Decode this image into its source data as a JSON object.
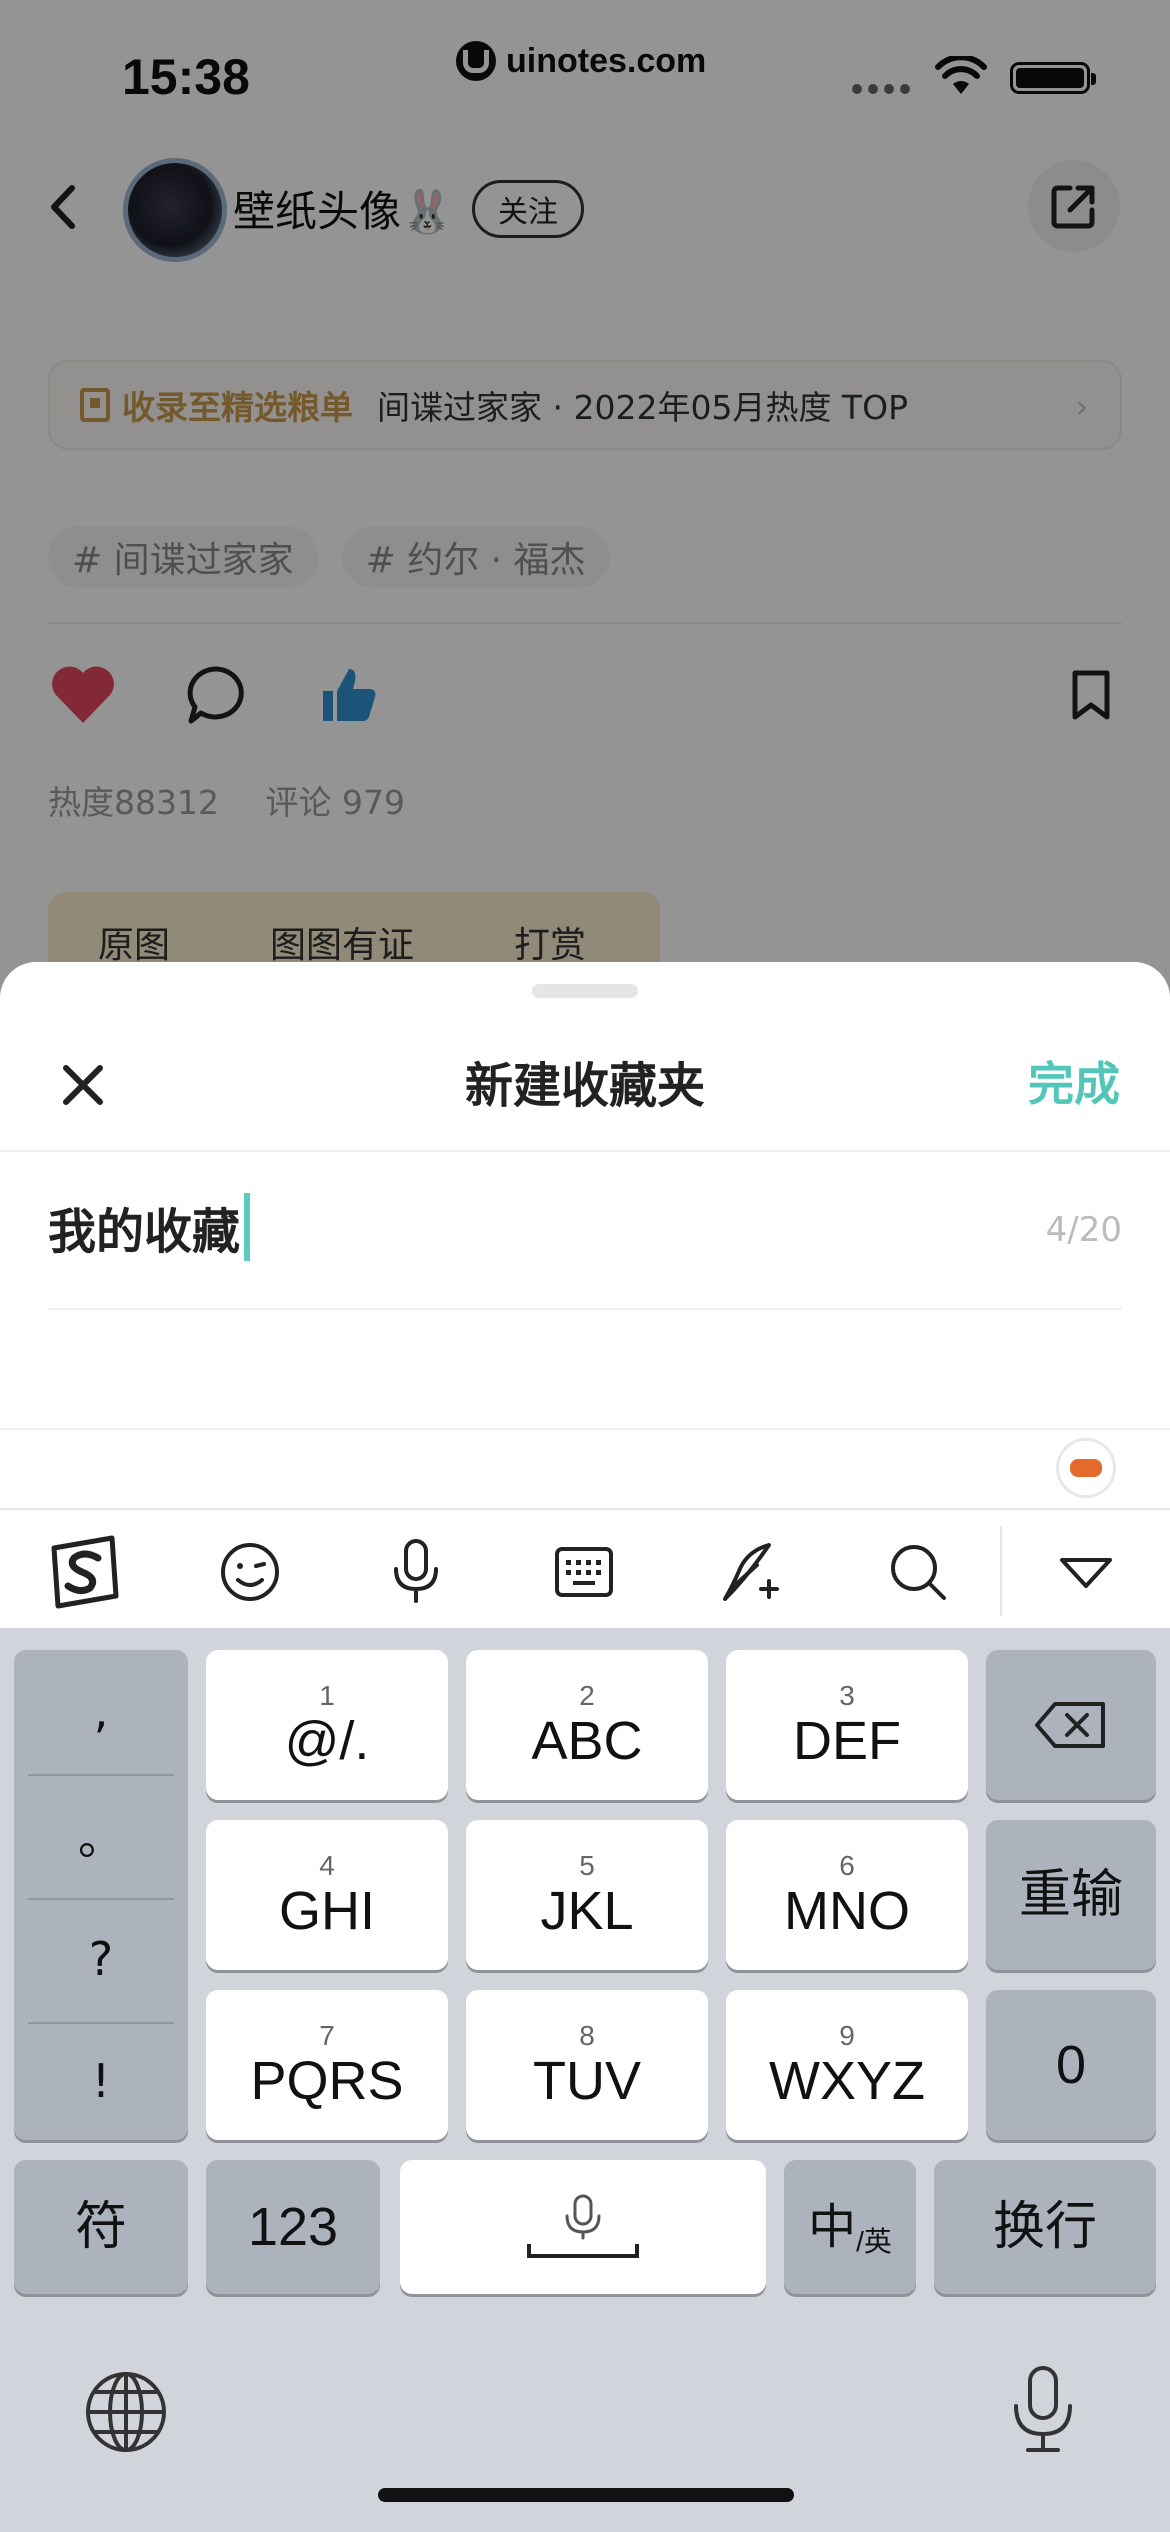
{
  "status_bar": {
    "time": "15:38",
    "watermark": "uinotes.com"
  },
  "header": {
    "user_name": "壁纸头像🐰",
    "follow_label": "关注"
  },
  "collection_banner": {
    "tag": "收录至精选粮单",
    "text": "间谍过家家 · 2022年05月热度 TOP",
    "arrow": "›"
  },
  "topic_tags": [
    "# 间谍过家家",
    "# 约尔 · 福杰"
  ],
  "stats": {
    "heat": "热度88312",
    "comments": "评论 979"
  },
  "content_tabs": [
    "原图",
    "图图有证",
    "打赏"
  ],
  "sheet": {
    "title": "新建收藏夹",
    "done_label": "完成",
    "input_value": "我的收藏",
    "counter": "4/20"
  },
  "keyboard": {
    "punctuation": [
      ",",
      "。",
      "?",
      "!"
    ],
    "keys": [
      {
        "num": "1",
        "label": "@/."
      },
      {
        "num": "2",
        "label": "ABC"
      },
      {
        "num": "3",
        "label": "DEF"
      },
      {
        "num": "4",
        "label": "GHI"
      },
      {
        "num": "5",
        "label": "JKL"
      },
      {
        "num": "6",
        "label": "MNO"
      },
      {
        "num": "7",
        "label": "PQRS"
      },
      {
        "num": "8",
        "label": "TUV"
      },
      {
        "num": "9",
        "label": "WXYZ"
      }
    ],
    "reset_label": "重输",
    "zero_label": "0",
    "symbol_label": "符",
    "numbers_label": "123",
    "lang_main": "中",
    "lang_sub": "/英",
    "return_label": "换行"
  },
  "colors": {
    "accent": "#51c6b9",
    "caret": "#5ccbbf",
    "banner_gold": "#c69a4b",
    "like_red": "#e0485c",
    "thumb_blue": "#2f8fd0"
  }
}
